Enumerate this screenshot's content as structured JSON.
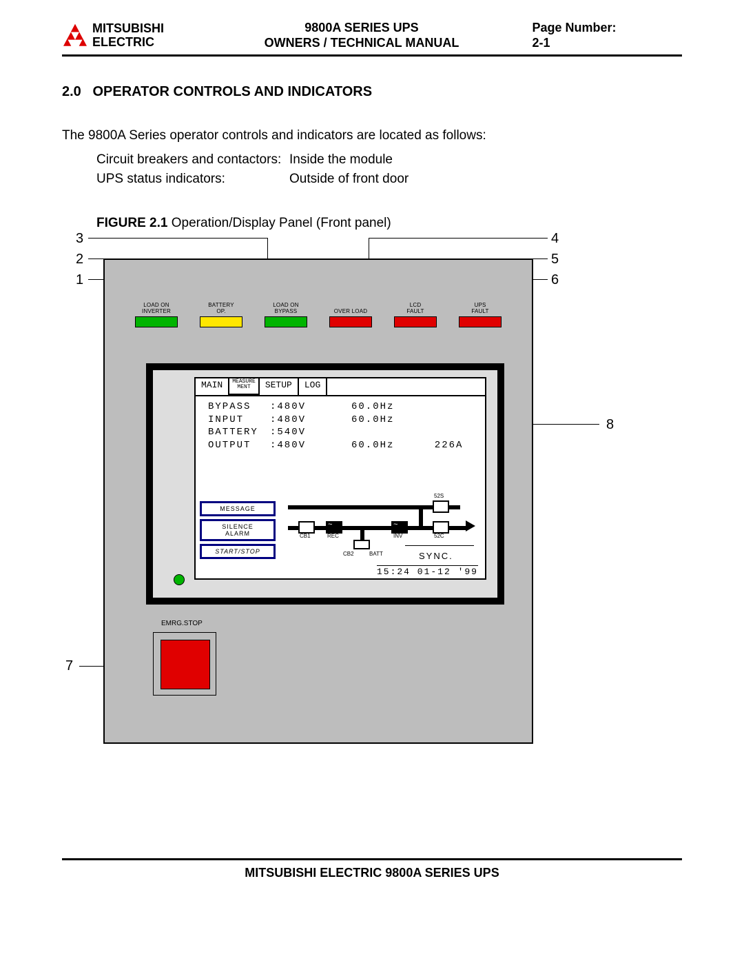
{
  "header": {
    "brand_line1": "MITSUBISHI",
    "brand_line2": "ELECTRIC",
    "title_line1": "9800A SERIES UPS",
    "title_line2": "OWNERS / TECHNICAL MANUAL",
    "page_label": "Page Number:",
    "page_number": "2-1"
  },
  "section": {
    "number": "2.0",
    "title": "OPERATOR CONTROLS AND INDICATORS"
  },
  "intro": "The 9800A Series operator controls and indicators are located as follows:",
  "rows": [
    {
      "label": "Circuit breakers and contactors:",
      "value": "Inside the module"
    },
    {
      "label": "UPS status indicators:",
      "value": "Outside of front door"
    }
  ],
  "figure": {
    "label": "FIGURE 2.1",
    "caption": "Operation/Display Panel (Front panel)"
  },
  "callouts": {
    "c1": "1",
    "c2": "2",
    "c3": "3",
    "c4": "4",
    "c5": "5",
    "c6": "6",
    "c7": "7",
    "c8": "8"
  },
  "leds": [
    {
      "line1": "LOAD ON",
      "line2": "INVERTER",
      "color": "green"
    },
    {
      "line1": "BATTERY",
      "line2": "OP.",
      "color": "yellow"
    },
    {
      "line1": "LOAD ON",
      "line2": "BYPASS",
      "color": "green"
    },
    {
      "line1": "",
      "line2": "OVER LOAD",
      "color": "red"
    },
    {
      "line1": "LCD",
      "line2": "FAULT",
      "color": "red"
    },
    {
      "line1": "UPS",
      "line2": "FAULT",
      "color": "red"
    }
  ],
  "lcd": {
    "tabs": {
      "tab1": "MAIN",
      "tab2a": "MEASURE",
      "tab2b": "MENT",
      "tab3": "SETUP",
      "tab4": "LOG"
    },
    "lines": [
      {
        "name": "BYPASS",
        "sep": ":",
        "volt": "480V",
        "freq": "60.0Hz",
        "amps": ""
      },
      {
        "name": "INPUT",
        "sep": ":",
        "volt": "480V",
        "freq": "60.0Hz",
        "amps": ""
      },
      {
        "name": "BATTERY",
        "sep": ":",
        "volt": "540V",
        "freq": "",
        "amps": ""
      },
      {
        "name": "OUTPUT",
        "sep": ":",
        "volt": "480V",
        "freq": "60.0Hz",
        "amps": "226A"
      }
    ],
    "soft_buttons": {
      "b1": "MESSAGE",
      "b2_l1": "SILENCE",
      "b2_l2": "ALARM",
      "b3_l1": "START/",
      "b3_l2": "STOP"
    },
    "diagram_labels": {
      "cb1": "CB1",
      "rec": "REC",
      "cb2": "CB2",
      "batt": "BATT",
      "inv": "INV",
      "s2s": "52S",
      "s2c": "52C",
      "sync": "SYNC."
    },
    "timestamp": "15:24 01-12 '99"
  },
  "emrg_label": "EMRG.STOP",
  "footer": "MITSUBISHI ELECTRIC 9800A SERIES UPS"
}
